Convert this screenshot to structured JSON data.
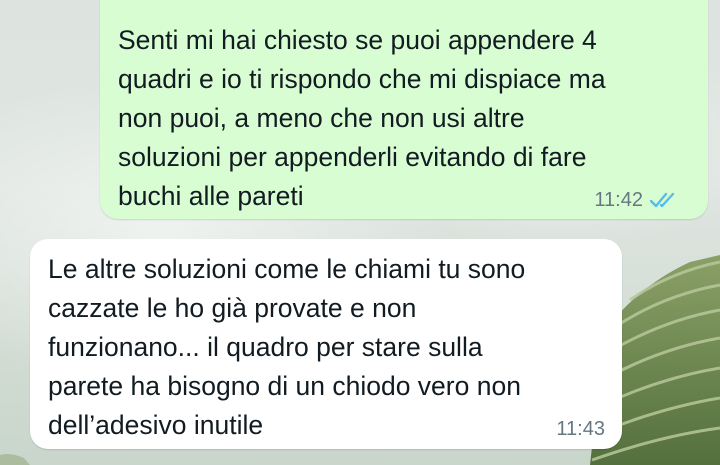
{
  "messages": [
    {
      "direction": "outgoing",
      "text": "Senti mi hai chiesto se puoi appendere 4\nquadri e io ti rispondo che mi dispiace ma\nnon puoi, a meno che non usi altre\nsoluzioni per appenderli evitando di fare\nbuchi alle pareti",
      "time": "11:42",
      "status": "read",
      "status_icon": "double-check-icon",
      "bubble_color": "#d9fdd3",
      "tick_color": "#53bdeb"
    },
    {
      "direction": "incoming",
      "text": "Le altre soluzioni come le chiami tu sono\ncazzate le ho già provate e non\nfunzionano... il quadro per stare sulla\nparete ha bisogno di un chiodo vero non\ndell’adesivo inutile",
      "time": "11:43",
      "bubble_color": "#ffffff"
    }
  ],
  "wallpaper": {
    "description_colors": {
      "sky": "#dde4e0",
      "terraces": "#6f8a52"
    }
  }
}
